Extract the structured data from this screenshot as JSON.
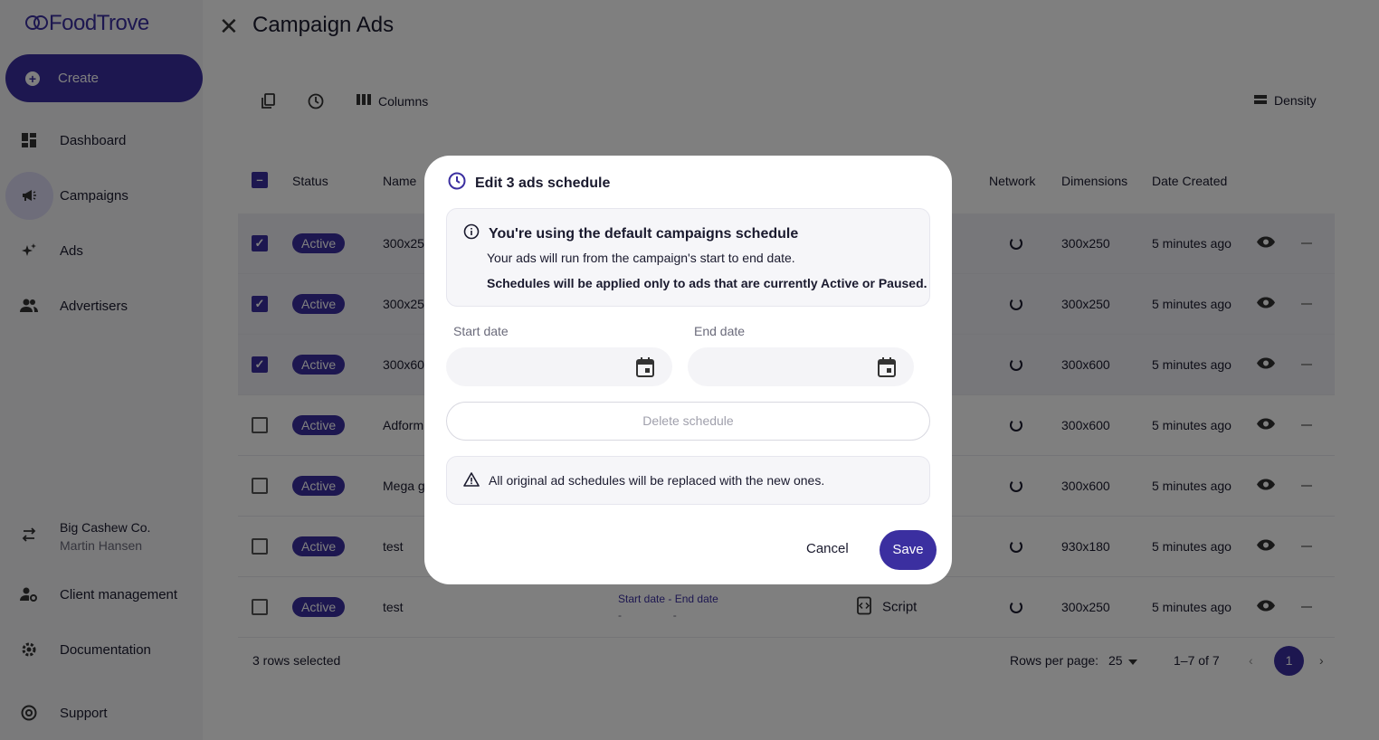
{
  "app": {
    "logo_text": "FoodTrove"
  },
  "sidebar": {
    "create_label": "Create",
    "items": [
      {
        "label": "Dashboard",
        "icon": "dashboard-icon"
      },
      {
        "label": "Campaigns",
        "icon": "megaphone-icon",
        "active": true
      },
      {
        "label": "Ads",
        "icon": "sparkle-icon"
      },
      {
        "label": "Advertisers",
        "icon": "people-icon"
      }
    ],
    "account": {
      "company": "Big Cashew Co.",
      "user": "Martin Hansen"
    },
    "bottom_items": [
      {
        "label": "Client management",
        "icon": "manage-accounts-icon"
      },
      {
        "label": "Documentation",
        "icon": "gear-icon"
      },
      {
        "label": "Support",
        "icon": "support-icon"
      }
    ]
  },
  "header": {
    "title": "Campaign Ads"
  },
  "toolbar": {
    "columns_label": "Columns",
    "density_label": "Density"
  },
  "table": {
    "headers": {
      "status": "Status",
      "name": "Name",
      "network": "Network",
      "dimensions": "Dimensions",
      "date_created": "Date Created"
    },
    "rows": [
      {
        "checked": true,
        "status": "Active",
        "name": "300x25",
        "dimensions": "300x250",
        "date": "5 minutes ago"
      },
      {
        "checked": true,
        "status": "Active",
        "name": "300x25",
        "dimensions": "300x250",
        "date": "5 minutes ago"
      },
      {
        "checked": true,
        "status": "Active",
        "name": "300x60",
        "dimensions": "300x600",
        "date": "5 minutes ago"
      },
      {
        "checked": false,
        "status": "Active",
        "name": "Adform",
        "dimensions": "300x600",
        "date": "5 minutes ago"
      },
      {
        "checked": false,
        "status": "Active",
        "name": "Mega g",
        "dimensions": "300x600",
        "date": "5 minutes ago"
      },
      {
        "checked": false,
        "status": "Active",
        "name": "test",
        "dimensions": "930x180",
        "date": "5 minutes ago"
      },
      {
        "checked": false,
        "status": "Active",
        "name": "test",
        "dimensions": "300x250",
        "date": "5 minutes ago",
        "schedule": {
          "start_label": "Start date",
          "sep": "-",
          "end_label": "End date",
          "start_value": "-",
          "end_value": "-"
        },
        "type": "Script"
      }
    ]
  },
  "footer": {
    "selected_text": "3 rows selected",
    "rows_per_page_label": "Rows per page:",
    "rows_per_page_value": "25",
    "range_text": "1–7 of 7",
    "current_page": "1"
  },
  "modal": {
    "title": "Edit 3 ads schedule",
    "info_heading": "You're using the default campaigns schedule",
    "info_line1": "Your ads will run from the campaign's start to end date.",
    "info_line2": "Schedules will be applied only to ads that are currently Active or Paused.",
    "start_label": "Start date",
    "end_label": "End date",
    "start_value": "",
    "end_value": "",
    "delete_label": "Delete schedule",
    "warning": "All original ad schedules will be replaced with the new ones.",
    "cancel_label": "Cancel",
    "save_label": "Save"
  },
  "colors": {
    "accent": "#3b2fa0",
    "overlay": "rgba(0,0,0,0.5)"
  }
}
